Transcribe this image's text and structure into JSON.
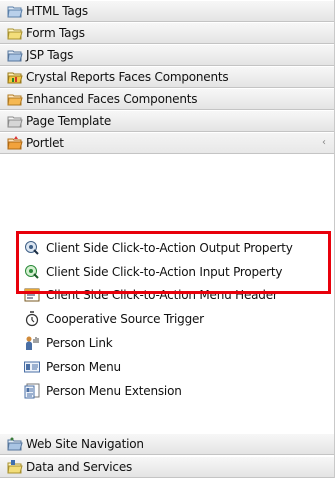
{
  "drawers_top": [
    {
      "label": "HTML Tags",
      "icon": "html-tags-icon"
    },
    {
      "label": "Form Tags",
      "icon": "form-tags-icon"
    },
    {
      "label": "JSP Tags",
      "icon": "jsp-tags-icon"
    },
    {
      "label": "Crystal Reports Faces Components",
      "icon": "crystal-reports-icon"
    },
    {
      "label": "Enhanced Faces Components",
      "icon": "enhanced-faces-icon"
    },
    {
      "label": "Page Template",
      "icon": "page-template-icon"
    },
    {
      "label": "Portlet",
      "icon": "portlet-icon"
    }
  ],
  "portlet_items": [
    {
      "label": "Client Side Click-to-Action Output Property",
      "icon": "output-property-icon"
    },
    {
      "label": "Client Side Click-to-Action Input Property",
      "icon": "input-property-icon"
    },
    {
      "label": "Client Side Click-to-Action Menu Header",
      "icon": "menu-header-icon"
    },
    {
      "label": "Cooperative Source Trigger",
      "icon": "source-trigger-icon"
    },
    {
      "label": "Person Link",
      "icon": "person-link-icon"
    },
    {
      "label": "Person Menu",
      "icon": "person-menu-icon"
    },
    {
      "label": "Person Menu Extension",
      "icon": "person-menu-extension-icon"
    }
  ],
  "drawers_bottom": [
    {
      "label": "Web Site Navigation",
      "icon": "web-site-navigation-icon"
    },
    {
      "label": "Data and Services",
      "icon": "data-services-icon"
    }
  ],
  "highlight_color": "#e8000b"
}
